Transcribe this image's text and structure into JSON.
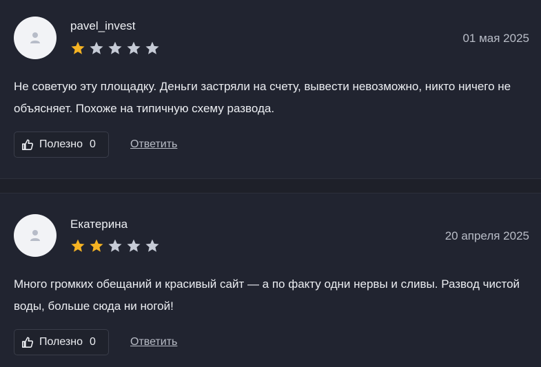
{
  "reviews": [
    {
      "author": "pavel_invest",
      "date": "01 мая 2025",
      "rating": 1,
      "max_rating": 5,
      "text": "Не советую эту площадку. Деньги застряли на счету, вывести невозможно, никто ничего не объясняет. Похоже на типичную схему развода.",
      "useful_label": "Полезно",
      "useful_count": "0",
      "reply_label": "Ответить"
    },
    {
      "author": "Екатерина",
      "date": "20 апреля 2025",
      "rating": 2,
      "max_rating": 5,
      "text": "Много громких обещаний и красивый сайт — а по факту одни нервы и сливы. Развод чистой воды, больше сюда ни ногой!",
      "useful_label": "Полезно",
      "useful_count": "0",
      "reply_label": "Ответить"
    }
  ],
  "colors": {
    "star_filled": "#f5b323",
    "star_empty": "#c6cbd6",
    "avatar_icon": "#b7bcc8"
  },
  "icons": {
    "avatar": "user-icon",
    "useful": "thumbs-up-icon",
    "star": "star-icon"
  }
}
